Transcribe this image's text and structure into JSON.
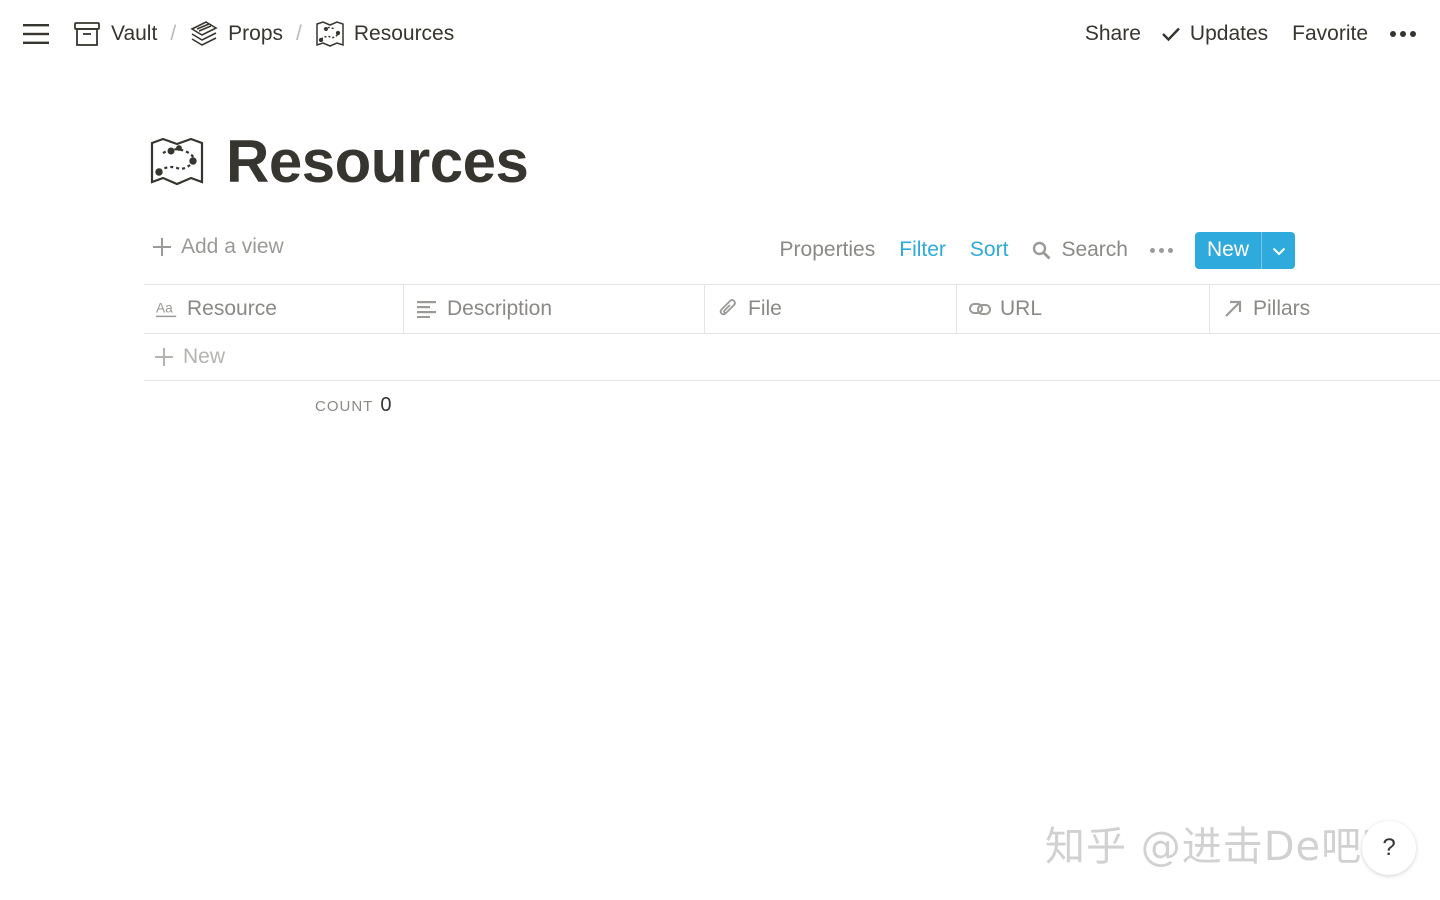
{
  "topbar": {
    "menu_icon": "hamburger-menu-icon",
    "breadcrumb": [
      {
        "label": "Vault",
        "icon": "archive-box-icon"
      },
      {
        "label": "Props",
        "icon": "stacked-layers-icon"
      },
      {
        "label": "Resources",
        "icon": "treasure-map-icon"
      }
    ],
    "separator": "/",
    "actions": {
      "share": "Share",
      "updates": "Updates",
      "favorite": "Favorite"
    }
  },
  "page": {
    "title": "Resources",
    "icon": "treasure-map-icon"
  },
  "view_bar": {
    "add_view": "Add a view",
    "properties": "Properties",
    "filter": "Filter",
    "sort": "Sort",
    "search": "Search",
    "new_button": "New",
    "accent_color": "#2eaadc"
  },
  "table": {
    "columns": [
      {
        "label": "Resource",
        "icon": "text-aa-icon"
      },
      {
        "label": "Description",
        "icon": "text-lines-icon"
      },
      {
        "label": "File",
        "icon": "paperclip-icon"
      },
      {
        "label": "URL",
        "icon": "link-icon"
      },
      {
        "label": "Pillars",
        "icon": "relation-arrow-icon"
      }
    ],
    "new_row_label": "New",
    "count_label": "COUNT",
    "count_value": "0"
  },
  "watermark": "知乎 @进击De吧唧",
  "help_label": "?"
}
